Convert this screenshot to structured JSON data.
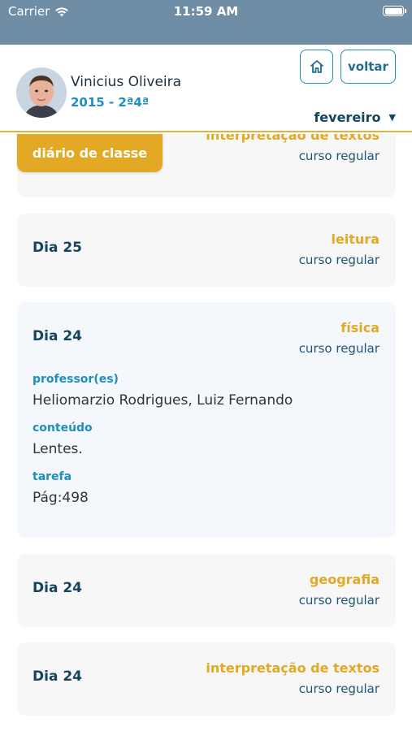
{
  "status_bar": {
    "carrier": "Carrier",
    "time": "11:59 AM",
    "wifi_icon": "wifi-icon",
    "battery_icon": "battery-icon"
  },
  "header": {
    "student_name": "Vinicius Oliveira",
    "student_class": "2015 - 2ª4ª",
    "home_icon": "home-icon",
    "back_label": "voltar",
    "month": "fevereiro",
    "month_icon": "caret-down-icon"
  },
  "tab_badge": "diário de classe",
  "entries": [
    {
      "day": "",
      "subject": "interpretação de textos",
      "course": "curso regular"
    },
    {
      "day": "Dia 25",
      "subject": "leitura",
      "course": "curso regular"
    },
    {
      "day": "Dia 24",
      "subject": "física",
      "course": "curso regular",
      "details": [
        {
          "label": "professor(es)",
          "value": "Heliomarzio Rodrigues, Luiz Fernando"
        },
        {
          "label": "conteúdo",
          "value": "Lentes."
        },
        {
          "label": "tarefa",
          "value": "Pág:498"
        }
      ]
    },
    {
      "day": "Dia 24",
      "subject": "geografia",
      "course": "curso regular"
    },
    {
      "day": "Dia 24",
      "subject": "interpretação de textos",
      "course": "curso regular"
    }
  ],
  "colors": {
    "status_bar": "#6f8ea6",
    "accent_gold": "#e3a925",
    "accent_blue": "#1e8fbf",
    "dark_blue": "#15445d"
  }
}
